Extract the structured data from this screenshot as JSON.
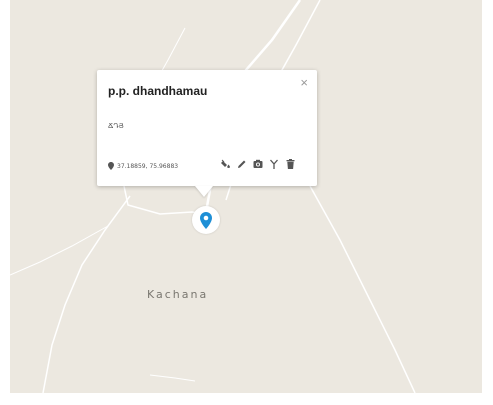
{
  "map": {
    "place_label": "Kachana",
    "background_color": "#ece8e0",
    "road_color": "#ffffff"
  },
  "popup": {
    "title": "p.p. dhandhamau",
    "close_symbol": "×",
    "description": "ՃԴՅ",
    "coordinates": "37.18859, 75.96883",
    "actions": [
      "paint-bucket-icon",
      "pencil-icon",
      "camera-icon",
      "route-fork-icon",
      "trash-icon"
    ]
  },
  "marker": {
    "icon": "map-pin-icon",
    "color": "#1e8fd6"
  }
}
